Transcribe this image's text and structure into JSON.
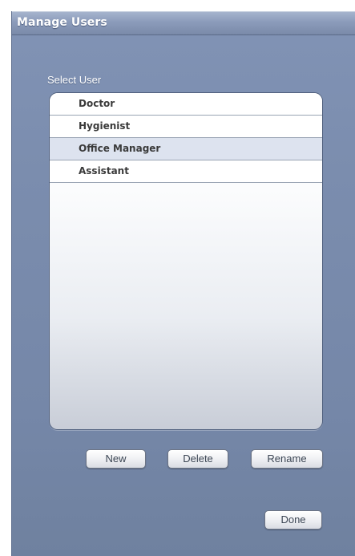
{
  "window": {
    "title": "Manage Users"
  },
  "select_user": {
    "label": "Select User",
    "selected": "Office Manager",
    "items": [
      {
        "label": "Doctor"
      },
      {
        "label": "Hygienist"
      },
      {
        "label": "Office Manager"
      },
      {
        "label": "Assistant"
      }
    ]
  },
  "buttons": {
    "new": "New",
    "delete": "Delete",
    "rename": "Rename",
    "done": "Done"
  }
}
